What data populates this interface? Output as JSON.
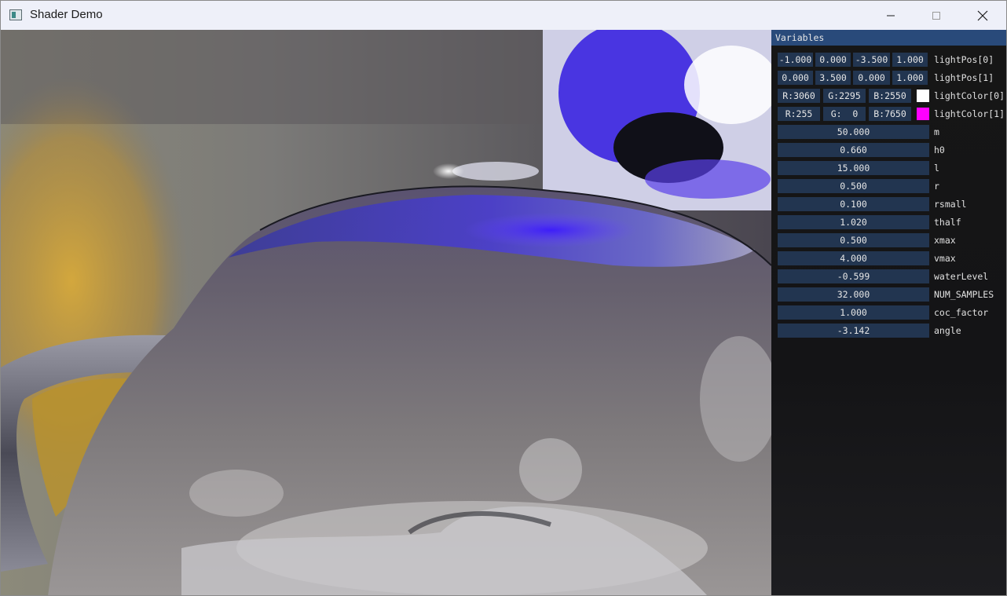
{
  "window": {
    "title": "Shader Demo"
  },
  "panel": {
    "title": "Variables",
    "vec_rows": [
      {
        "label": "lightPos[0]",
        "values": [
          "-1.000",
          "0.000",
          "-3.500",
          "1.000"
        ]
      },
      {
        "label": "lightPos[1]",
        "values": [
          "0.000",
          "3.500",
          "0.000",
          "1.000"
        ]
      }
    ],
    "color_rows": [
      {
        "label": "lightColor[0]",
        "values": [
          "R:3060",
          "G:2295",
          "B:2550"
        ],
        "swatch": "#ffffff"
      },
      {
        "label": "lightColor[1]",
        "values": [
          "R:255",
          "G:  0",
          "B:7650"
        ],
        "swatch": "#ff00ff"
      }
    ],
    "sliders": [
      {
        "label": "m",
        "value": "50.000"
      },
      {
        "label": "h0",
        "value": "0.660"
      },
      {
        "label": "l",
        "value": "15.000"
      },
      {
        "label": "r",
        "value": "0.500"
      },
      {
        "label": "rsmall",
        "value": "0.100"
      },
      {
        "label": "thalf",
        "value": "1.020"
      },
      {
        "label": "xmax",
        "value": "0.500"
      },
      {
        "label": "vmax",
        "value": "4.000"
      },
      {
        "label": "waterLevel",
        "value": "-0.599"
      },
      {
        "label": "NUM_SAMPLES",
        "value": "32.000"
      },
      {
        "label": "coc_factor",
        "value": "1.000"
      },
      {
        "label": "angle",
        "value": "-3.142"
      }
    ]
  },
  "icons": {
    "app": "app-icon",
    "minimize": "minimize-icon",
    "maximize": "maximize-icon",
    "close": "close-icon"
  },
  "colors": {
    "titlebar": "#eef0f9",
    "panel_header": "#294a7a",
    "field_bg": "#223550",
    "swatch_white": "#ffffff",
    "swatch_magenta": "#ff00ff"
  }
}
